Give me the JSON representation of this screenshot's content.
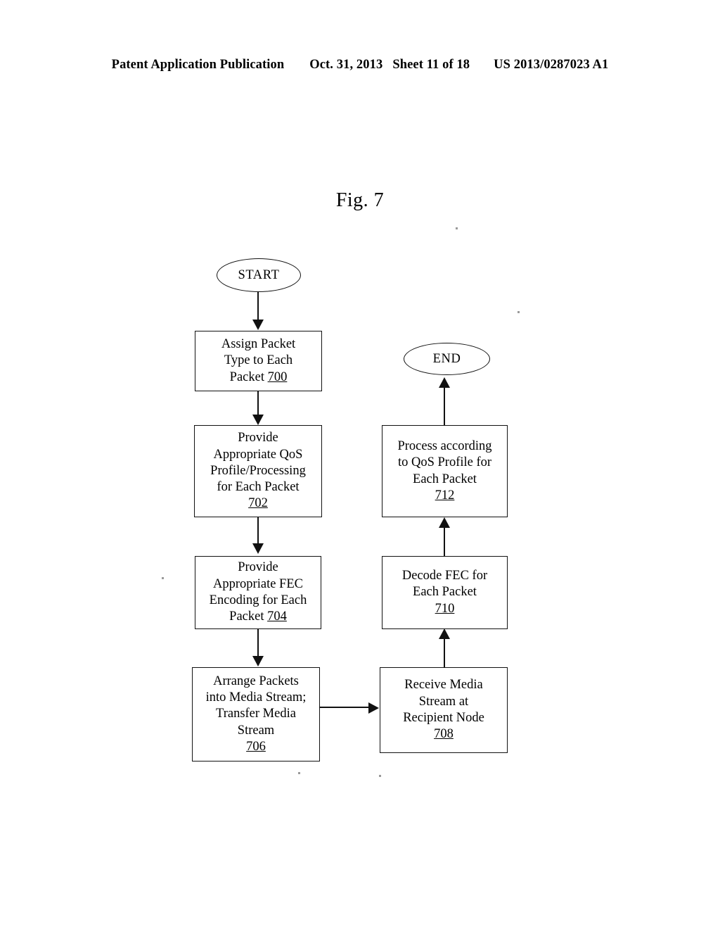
{
  "header": {
    "publication": "Patent Application Publication",
    "date": "Oct. 31, 2013",
    "sheet": "Sheet 11 of 18",
    "patent_number": "US 2013/0287023 A1"
  },
  "figure": {
    "title": "Fig. 7"
  },
  "flowchart": {
    "nodes": {
      "start": {
        "shape": "terminator",
        "label": "START"
      },
      "end": {
        "shape": "terminator",
        "label": "END"
      },
      "step700": {
        "shape": "process",
        "ref": "700",
        "lines": [
          "Assign Packet",
          "Type to Each",
          "Packet "
        ],
        "line1": "Assign Packet",
        "line2": "Type to Each",
        "line3": "Packet ",
        "ref_inline": "700"
      },
      "step702": {
        "shape": "process",
        "ref": "702",
        "line1": "Provide",
        "line2": "Appropriate QoS",
        "line3": "Profile/Processing",
        "line4": "for Each Packet",
        "ref_line": "702"
      },
      "step704": {
        "shape": "process",
        "ref": "704",
        "line1": "Provide",
        "line2": "Appropriate FEC",
        "line3": "Encoding for Each",
        "line4": "Packet ",
        "ref_inline": "704"
      },
      "step706": {
        "shape": "process",
        "ref": "706",
        "line1": "Arrange Packets",
        "line2": "into Media Stream;",
        "line3": "Transfer Media",
        "line4": "Stream",
        "ref_line": "706"
      },
      "step708": {
        "shape": "process",
        "ref": "708",
        "line1": "Receive Media",
        "line2": "Stream at",
        "line3": "Recipient Node",
        "ref_line": "708"
      },
      "step710": {
        "shape": "process",
        "ref": "710",
        "line1": "Decode FEC for",
        "line2": "Each Packet",
        "ref_line": "710"
      },
      "step712": {
        "shape": "process",
        "ref": "712",
        "line1": "Process according",
        "line2": "to QoS Profile for",
        "line3": "Each Packet",
        "ref_line": "712"
      }
    },
    "edges": [
      {
        "from": "start",
        "to": "step700",
        "direction": "down"
      },
      {
        "from": "step700",
        "to": "step702",
        "direction": "down"
      },
      {
        "from": "step702",
        "to": "step704",
        "direction": "down"
      },
      {
        "from": "step704",
        "to": "step706",
        "direction": "down"
      },
      {
        "from": "step706",
        "to": "step708",
        "direction": "right"
      },
      {
        "from": "step708",
        "to": "step710",
        "direction": "up"
      },
      {
        "from": "step710",
        "to": "step712",
        "direction": "up"
      },
      {
        "from": "step712",
        "to": "end",
        "direction": "up"
      }
    ]
  },
  "colors": {
    "ink": "#111111",
    "page": "#ffffff"
  }
}
